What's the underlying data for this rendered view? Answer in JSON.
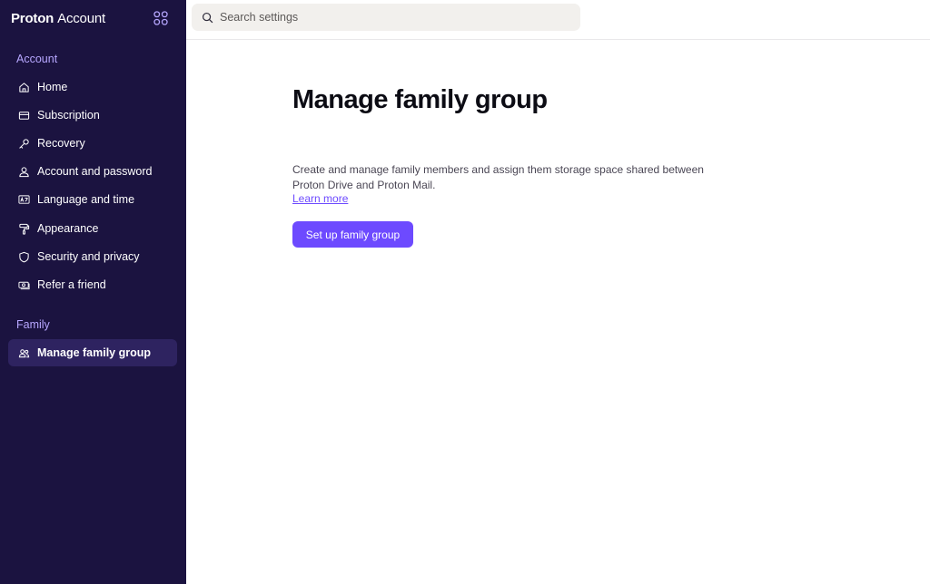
{
  "brand": {
    "name": "Proton",
    "product": "Account"
  },
  "search": {
    "placeholder": "Search settings",
    "value": ""
  },
  "sidebar": {
    "sections": [
      {
        "title": "Account",
        "items": [
          {
            "label": "Home",
            "icon": "house-icon"
          },
          {
            "label": "Subscription",
            "icon": "credit-card-icon"
          },
          {
            "label": "Recovery",
            "icon": "key-icon"
          },
          {
            "label": "Account and password",
            "icon": "user-icon"
          },
          {
            "label": "Language and time",
            "icon": "language-icon"
          },
          {
            "label": "Appearance",
            "icon": "paint-roller-icon"
          },
          {
            "label": "Security and privacy",
            "icon": "shield-icon"
          },
          {
            "label": "Refer a friend",
            "icon": "money-bills-icon"
          }
        ]
      },
      {
        "title": "Family",
        "items": [
          {
            "label": "Manage family group",
            "icon": "users-icon",
            "active": true
          }
        ]
      }
    ]
  },
  "main": {
    "title": "Manage family group",
    "description": "Create and manage family members and assign them storage space shared between Proton Drive and Proton Mail.",
    "learn_more": "Learn more",
    "cta": "Set up family group"
  },
  "colors": {
    "sidebar_bg": "#1b1340",
    "sidebar_active_bg": "#2e2360",
    "section_title": "#b7a7ff",
    "accent": "#6d4aff"
  }
}
